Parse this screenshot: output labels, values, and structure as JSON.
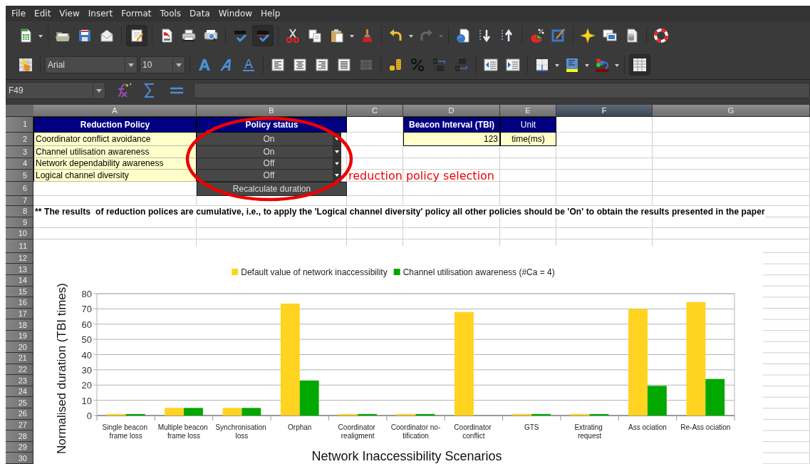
{
  "menu": [
    "File",
    "Edit",
    "View",
    "Insert",
    "Format",
    "Tools",
    "Data",
    "Window",
    "Help"
  ],
  "toolbars": [
    {
      "items": [
        {
          "kind": "spreadsheet",
          "pressed": false,
          "disabled": false
        },
        {
          "kind": "caret",
          "pressed": false,
          "disabled": false
        },
        {
          "kind": "separator"
        },
        {
          "kind": "folder",
          "pressed": false,
          "disabled": false
        },
        {
          "kind": "save",
          "pressed": false,
          "disabled": false
        },
        {
          "kind": "mail",
          "pressed": false,
          "disabled": false
        },
        {
          "kind": "separator"
        },
        {
          "kind": "edit",
          "pressed": true,
          "disabled": false
        },
        {
          "kind": "separator"
        },
        {
          "kind": "pdf",
          "pressed": false,
          "disabled": false
        },
        {
          "kind": "print",
          "pressed": false,
          "disabled": false
        },
        {
          "kind": "preview",
          "pressed": false,
          "disabled": false
        },
        {
          "kind": "separator"
        },
        {
          "kind": "spell",
          "pressed": false,
          "disabled": false
        },
        {
          "kind": "autospell",
          "pressed": true,
          "disabled": false
        },
        {
          "kind": "separator"
        },
        {
          "kind": "cut",
          "pressed": false,
          "disabled": false
        },
        {
          "kind": "copy",
          "pressed": false,
          "disabled": false
        },
        {
          "kind": "paste",
          "pressed": false,
          "disabled": false
        },
        {
          "kind": "caret",
          "pressed": false,
          "disabled": false
        },
        {
          "kind": "brush",
          "pressed": false,
          "disabled": false
        },
        {
          "kind": "separator"
        },
        {
          "kind": "undo",
          "pressed": false,
          "disabled": false
        },
        {
          "kind": "caret",
          "pressed": false,
          "disabled": false
        },
        {
          "kind": "redo",
          "pressed": false,
          "disabled": true
        },
        {
          "kind": "caret",
          "pressed": false,
          "disabled": true
        },
        {
          "kind": "separator"
        },
        {
          "kind": "globe",
          "pressed": false,
          "disabled": false
        },
        {
          "kind": "sortasc",
          "pressed": false,
          "disabled": false
        },
        {
          "kind": "sortdesc",
          "pressed": false,
          "disabled": false
        },
        {
          "kind": "separator"
        },
        {
          "kind": "chart",
          "pressed": false,
          "disabled": false
        },
        {
          "kind": "draw",
          "pressed": false,
          "disabled": false
        },
        {
          "kind": "separator"
        },
        {
          "kind": "star",
          "pressed": false,
          "disabled": false
        },
        {
          "kind": "gallery",
          "pressed": false,
          "disabled": false
        },
        {
          "kind": "datasource",
          "pressed": false,
          "disabled": false
        },
        {
          "kind": "separator"
        },
        {
          "kind": "help",
          "pressed": false,
          "disabled": false
        }
      ]
    },
    {
      "items": [
        {
          "kind": "styles",
          "pressed": false,
          "disabled": false
        },
        {
          "kind": "separator"
        },
        {
          "kind": "font-name",
          "value": "Arial"
        },
        {
          "kind": "font-size",
          "value": "10"
        },
        {
          "kind": "separator"
        },
        {
          "kind": "bold",
          "pressed": false,
          "disabled": false
        },
        {
          "kind": "italic",
          "pressed": false,
          "disabled": false
        },
        {
          "kind": "underline",
          "pressed": false,
          "disabled": false
        },
        {
          "kind": "separator"
        },
        {
          "kind": "align-left",
          "pressed": false,
          "disabled": false
        },
        {
          "kind": "align-center",
          "pressed": false,
          "disabled": false
        },
        {
          "kind": "align-right",
          "pressed": false,
          "disabled": false
        },
        {
          "kind": "justify",
          "pressed": false,
          "disabled": false
        },
        {
          "kind": "merge",
          "pressed": false,
          "disabled": true
        },
        {
          "kind": "separator"
        },
        {
          "kind": "currency",
          "pressed": false,
          "disabled": false
        },
        {
          "kind": "percent",
          "pressed": false,
          "disabled": false
        },
        {
          "kind": "add-decimal",
          "pressed": false,
          "disabled": false
        },
        {
          "kind": "delete-decimal",
          "pressed": false,
          "disabled": false
        },
        {
          "kind": "separator"
        },
        {
          "kind": "outdent",
          "pressed": false,
          "disabled": false
        },
        {
          "kind": "indent",
          "pressed": false,
          "disabled": false
        },
        {
          "kind": "separator"
        },
        {
          "kind": "borders",
          "pressed": false,
          "disabled": false
        },
        {
          "kind": "caret",
          "pressed": false,
          "disabled": false
        },
        {
          "kind": "bgcolor",
          "pressed": false,
          "disabled": false
        },
        {
          "kind": "caret",
          "pressed": false,
          "disabled": false
        },
        {
          "kind": "fontcolor",
          "pressed": false,
          "disabled": false
        },
        {
          "kind": "caret",
          "pressed": false,
          "disabled": false
        },
        {
          "kind": "separator"
        },
        {
          "kind": "grid",
          "pressed": true,
          "disabled": false
        }
      ]
    }
  ],
  "formula_bar": {
    "cell_ref": "F49"
  },
  "sheet": {
    "columns": [
      {
        "label": "A",
        "selected": false
      },
      {
        "label": "B",
        "selected": false
      },
      {
        "label": "C",
        "selected": false
      },
      {
        "label": "D",
        "selected": false
      },
      {
        "label": "E",
        "selected": false
      },
      {
        "label": "F",
        "selected": true
      },
      {
        "label": "G",
        "selected": false
      }
    ],
    "rows": [
      {
        "label": "1",
        "cells": [
          {
            "kind": "header",
            "text": "Reduction Policy"
          },
          {
            "kind": "header",
            "text": "Policy status"
          },
          {
            "kind": "empty"
          },
          {
            "kind": "header",
            "text": "Beacon Interval (TBI)"
          },
          {
            "kind": "header-plain",
            "text": "Unit"
          }
        ]
      },
      {
        "label": "2",
        "cells": [
          {
            "kind": "label",
            "text": "Coordinator conflict avoidance"
          },
          {
            "kind": "dropdown",
            "text": "On"
          },
          {
            "kind": "empty"
          },
          {
            "kind": "number",
            "text": "123"
          },
          {
            "kind": "unit",
            "text": "time(ms)"
          }
        ]
      },
      {
        "label": "3",
        "cells": [
          {
            "kind": "label",
            "text": "Channel utilisation awareness"
          },
          {
            "kind": "dropdown",
            "text": "On"
          }
        ]
      },
      {
        "label": "4",
        "cells": [
          {
            "kind": "label",
            "text": "Network dependability awareness"
          },
          {
            "kind": "dropdown",
            "text": "Off"
          }
        ]
      },
      {
        "label": "5",
        "cells": [
          {
            "kind": "label",
            "text": "Logical channel diversity"
          },
          {
            "kind": "dropdown",
            "text": "Off"
          },
          {
            "kind": "annotation",
            "text": "reduction policy selection"
          }
        ]
      },
      {
        "label": "6",
        "cells": [
          {
            "kind": "empty"
          },
          {
            "kind": "button",
            "text": "Recalculate duration"
          }
        ]
      },
      {
        "label": "7"
      },
      {
        "label": "8",
        "cells": [
          {
            "kind": "note",
            "text": "** The results  of reduction polices are cumulative, i.e., to apply the 'Logical channel diversity' policy all other policies should be 'On' to obtain the results presented in the paper"
          }
        ]
      },
      {
        "label": "9"
      },
      {
        "label": "10"
      },
      {
        "label": "11"
      },
      {
        "label": "12"
      },
      {
        "label": "13"
      },
      {
        "label": "14"
      },
      {
        "label": "15"
      },
      {
        "label": "16"
      },
      {
        "label": "17"
      },
      {
        "label": "18"
      },
      {
        "label": "19"
      },
      {
        "label": "20"
      },
      {
        "label": "21"
      },
      {
        "label": "22"
      },
      {
        "label": "23"
      },
      {
        "label": "24"
      },
      {
        "label": "25"
      },
      {
        "label": "26"
      },
      {
        "label": "27"
      },
      {
        "label": "28"
      },
      {
        "label": "29"
      },
      {
        "label": "30"
      }
    ]
  },
  "chart": {
    "chart_data": {
      "type": "bar",
      "legend": "top",
      "grid": true,
      "categories": [
        "Single beacon frame loss",
        "Multiple beacon frame loss",
        "Synchronisation loss",
        "Orphan",
        "Coordinator realigment",
        "Coordinator no-tification",
        "Coordinator conflict",
        "GTS",
        "Extrating request",
        "Ass ociation",
        "Re-Ass ociation"
      ],
      "series": [
        {
          "name": "Default value of network inaccessibility",
          "color": "#ffd320",
          "values": [
            1,
            5,
            5,
            73.5,
            1,
            1,
            68,
            1,
            1,
            70,
            74.5
          ]
        },
        {
          "name": "Channel utilisation awareness (#Ca = 4)",
          "color": "#00a800",
          "values": [
            1,
            5,
            5,
            23,
            1,
            1,
            0,
            1,
            1,
            19.5,
            24
          ]
        }
      ],
      "xlabel": "Network Inaccessibility Scenarios",
      "ylabel": "Normalised duration (TBI times)",
      "ylim": [
        0,
        80
      ],
      "yticks": [
        0,
        10,
        20,
        30,
        40,
        50,
        60,
        70,
        80
      ]
    }
  }
}
